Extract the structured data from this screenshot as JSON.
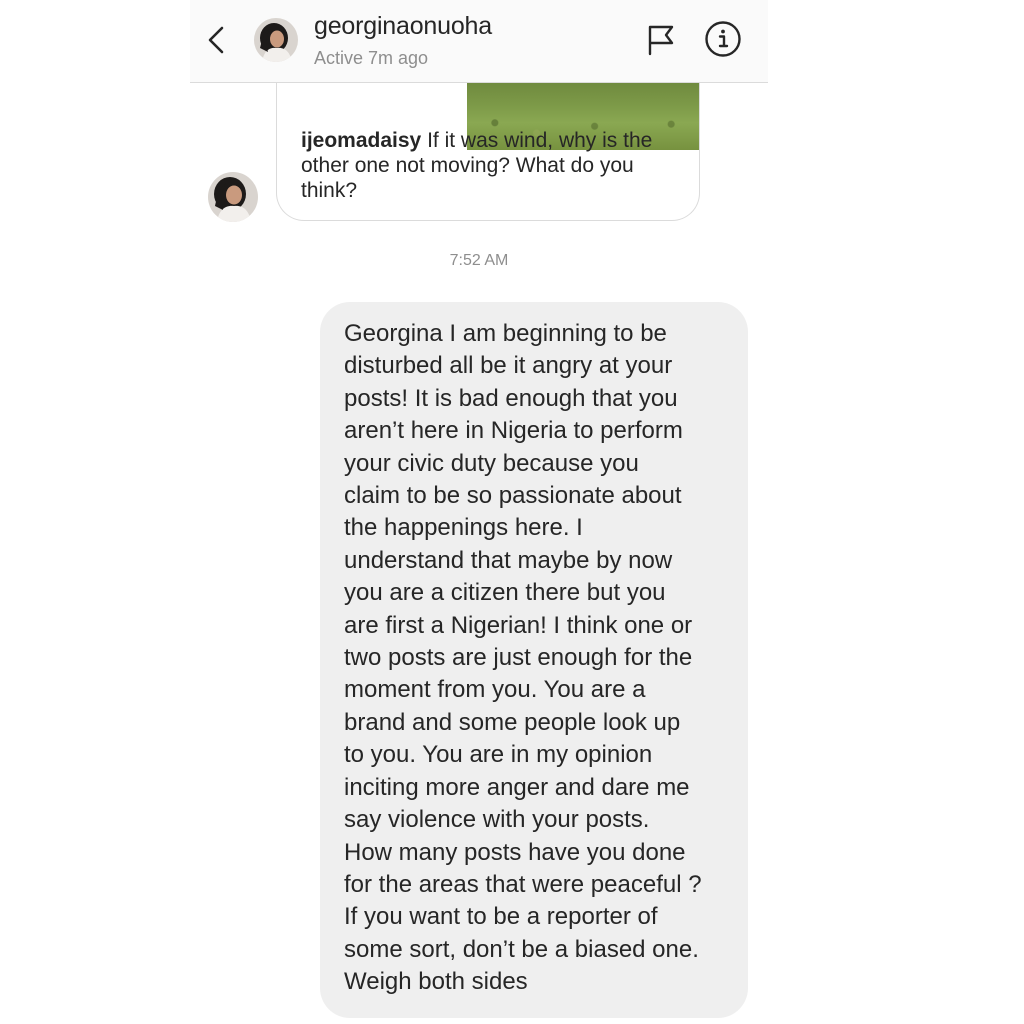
{
  "header": {
    "username": "georginaonuoha",
    "status": "Active 7m ago",
    "icons": {
      "back": "chevron-left-icon",
      "flag": "flag-icon",
      "info": "info-icon"
    }
  },
  "conversation": {
    "shared_post": {
      "caption_user": "ijeomadaisy",
      "caption_text": " If it was wind, why is the other one not moving? What do you think?"
    },
    "timestamp": "7:52 AM",
    "sent_message": "Georgina I am beginning to be\ndisturbed all be it angry at your\nposts! It is bad enough that you\naren’t here in Nigeria to perform\nyour civic duty because you\nclaim to be so passionate about\nthe happenings here. I\nunderstand that maybe by now\nyou are a citizen there but you\nare first a Nigerian! I think one or\ntwo posts are just enough for the\nmoment from you. You are a\nbrand and some people look up\nto you. You are in my opinion\ninciting more anger and dare me\nsay violence with your posts.\nHow many posts have you done\nfor the areas that were peaceful ?\nIf you want to be a reporter of\nsome sort, don’t be a biased one.\nWeigh both sides"
  },
  "colors": {
    "header_bg": "#fafafa",
    "sent_bubble_bg": "#efefef",
    "muted_text": "#8e8e8e",
    "primary_text": "#262626"
  }
}
